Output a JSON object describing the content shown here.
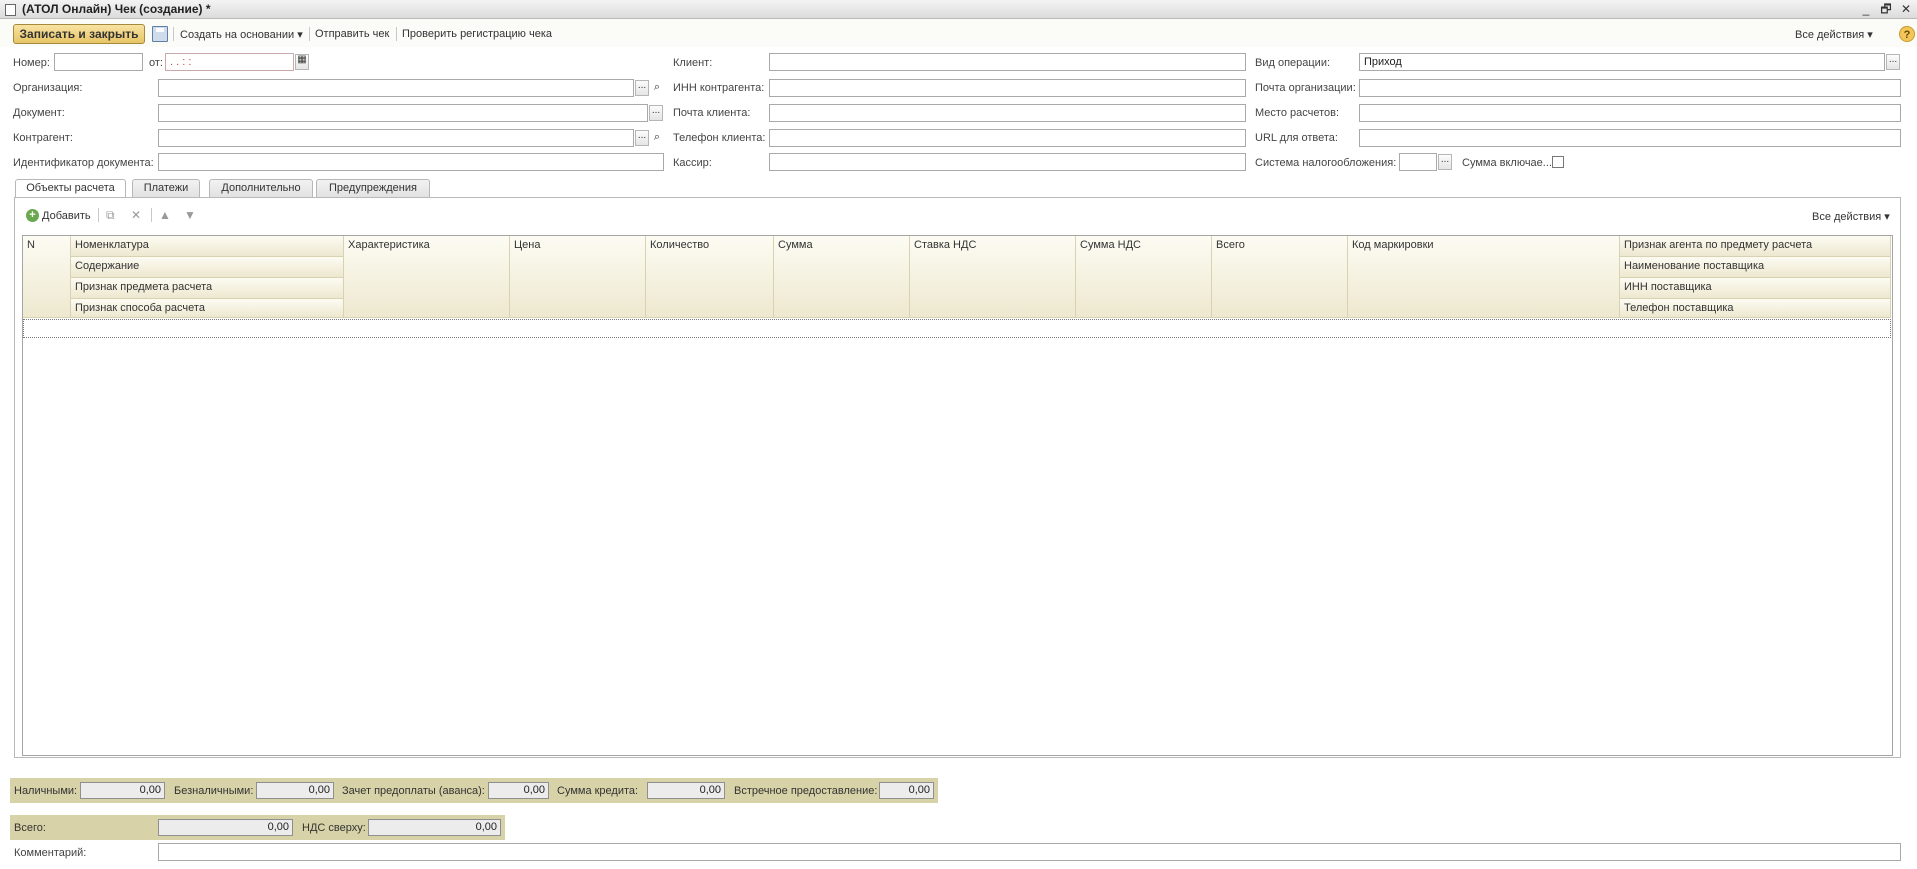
{
  "window": {
    "title": "(АТОЛ Онлайн) Чек (создание) *",
    "minimize": "_",
    "restore": "🗗",
    "close": "✕"
  },
  "toolbar": {
    "save_close": "Записать и закрыть",
    "create_based": "Создать на основании",
    "send_check": "Отправить чек",
    "verify_registration": "Проверить регистрацию чека",
    "all_actions": "Все действия",
    "help": "?"
  },
  "form": {
    "number_label": "Номер:",
    "number_value": "",
    "from_label": "от:",
    "date_value": " .  .      :  :",
    "organization_label": "Организация:",
    "document_label": "Документ:",
    "counterparty_label": "Контрагент:",
    "doc_id_label": "Идентификатор документа:",
    "client_label": "Клиент:",
    "inn_label": "ИНН контрагента:",
    "client_email_label": "Почта клиента:",
    "client_phone_label": "Телефон клиента:",
    "cashier_label": "Кассир:",
    "operation_label": "Вид операции:",
    "operation_value": "Приход",
    "org_email_label": "Почта организации:",
    "settlement_place_label": "Место расчетов:",
    "response_url_label": "URL для ответа:",
    "tax_system_label": "Система налогообложения:",
    "sum_includes_label": "Сумма включае..."
  },
  "tabs": [
    {
      "label": "Объекты расчета"
    },
    {
      "label": "Платежи"
    },
    {
      "label": "Дополнительно"
    },
    {
      "label": "Предупреждения"
    }
  ],
  "table_toolbar": {
    "add": "Добавить",
    "all_actions": "Все действия"
  },
  "table": {
    "headers": {
      "n": "N",
      "nomenclature": "Номенклатура",
      "content": "Содержание",
      "subject_sign": "Признак предмета расчета",
      "method_sign": "Признак способа расчета",
      "characteristic": "Характеристика",
      "price": "Цена",
      "quantity": "Количество",
      "sum": "Сумма",
      "vat_rate": "Ставка НДС",
      "vat_sum": "Сумма НДС",
      "total": "Всего",
      "marking_code": "Код маркировки",
      "agent_sign": "Признак агента по предмету расчета",
      "supplier_name": "Наименование поставщика",
      "supplier_inn": "ИНН поставщика",
      "supplier_phone": "Телефон поставщика"
    }
  },
  "payments": {
    "cash_label": "Наличными:",
    "cash": "0,00",
    "cashless_label": "Безналичными:",
    "cashless": "0,00",
    "prepay_label": "Зачет предоплаты (аванса):",
    "prepay": "0,00",
    "credit_label": "Сумма кредита:",
    "credit": "0,00",
    "counter_label": "Встречное предоставление:",
    "counter": "0,00"
  },
  "totals": {
    "total_label": "Всего:",
    "total": "0,00",
    "vat_label": "НДС сверху:",
    "vat": "0,00"
  },
  "comment": {
    "label": "Комментарий:",
    "value": ""
  }
}
